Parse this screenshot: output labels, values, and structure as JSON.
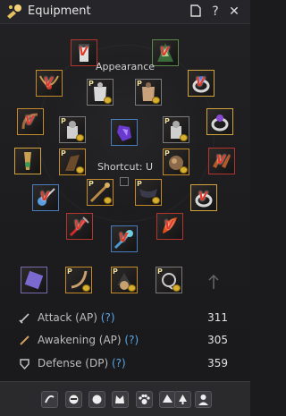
{
  "window": {
    "title": "Equipment",
    "buttons": [
      "page-icon",
      "help-icon",
      "close-icon"
    ]
  },
  "labels": {
    "appearance": "Appearance",
    "shortcut": "Shortcut: U",
    "p_marker": "P"
  },
  "stats": [
    {
      "name": "attack",
      "label": "Attack (AP)",
      "help": "(?)",
      "value": "311",
      "icon": "sword-icon"
    },
    {
      "name": "awakening",
      "label": "Awakening (AP)",
      "help": "(?)",
      "value": "305",
      "icon": "awakening-weapon-icon"
    },
    {
      "name": "defense",
      "label": "Defense (DP)",
      "help": "(?)",
      "value": "359",
      "icon": "shield-icon"
    }
  ],
  "bottom_buttons": [
    "transform-icon",
    "mask-icon",
    "dark-icon",
    "cat-ears-icon",
    "paw-icon",
    "hat-icon",
    "tree-icon",
    "character-icon"
  ],
  "colors": {
    "accent_gold": "#d2a43b",
    "stat_help": "#5aa7e6",
    "rarity_red": "#b3352e",
    "rarity_orange": "#c58a2a",
    "rarity_blue": "#4a7cc0"
  }
}
